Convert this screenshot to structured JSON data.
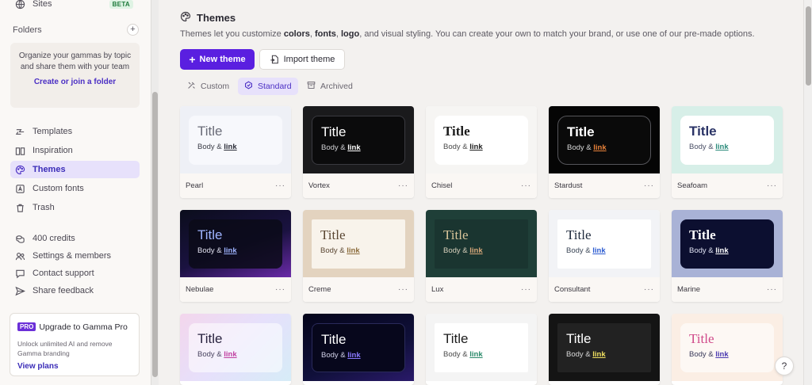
{
  "sidebar": {
    "sites_label": "Sites",
    "sites_badge": "BETA",
    "folders_heading": "Folders",
    "folders_add": "+",
    "folder_hint": "Organize your gammas by topic and share them with your team",
    "folder_link": "Create or join a folder",
    "nav": [
      {
        "label": "Templates",
        "icon": "templates-icon"
      },
      {
        "label": "Inspiration",
        "icon": "book-icon"
      },
      {
        "label": "Themes",
        "icon": "palette-icon"
      },
      {
        "label": "Custom fonts",
        "icon": "font-icon"
      },
      {
        "label": "Trash",
        "icon": "trash-icon"
      }
    ],
    "footer": [
      {
        "label": "400 credits",
        "icon": "coins-icon"
      },
      {
        "label": "Settings & members",
        "icon": "users-icon"
      },
      {
        "label": "Contact support",
        "icon": "chat-icon"
      },
      {
        "label": "Share feedback",
        "icon": "send-icon"
      }
    ],
    "promo": {
      "badge": "PRO",
      "title": "Upgrade to Gamma Pro",
      "desc": "Unlock unlimited AI and remove Gamma branding",
      "cta": "View plans"
    }
  },
  "main": {
    "title": "Themes",
    "desc_prefix": "Themes let you customize ",
    "desc_b1": "colors",
    "desc_sep1": ", ",
    "desc_b2": "fonts",
    "desc_sep2": ", ",
    "desc_b3": "logo",
    "desc_suffix": ", and visual styling. You can create your own to match your brand, or use one of our pre-made options.",
    "new_button": "New theme",
    "import_button": "Import theme",
    "tabs": [
      {
        "label": "Custom"
      },
      {
        "label": "Standard"
      },
      {
        "label": "Archived"
      }
    ],
    "sample_title": "Title",
    "sample_body": "Body & ",
    "sample_link": "link",
    "menu_dots": "···",
    "themes": [
      {
        "name": "Pearl"
      },
      {
        "name": "Vortex"
      },
      {
        "name": "Chisel"
      },
      {
        "name": "Stardust"
      },
      {
        "name": "Seafoam"
      },
      {
        "name": "Nebulae"
      },
      {
        "name": "Creme"
      },
      {
        "name": "Lux"
      },
      {
        "name": "Consultant"
      },
      {
        "name": "Marine"
      }
    ]
  },
  "help_label": "?"
}
